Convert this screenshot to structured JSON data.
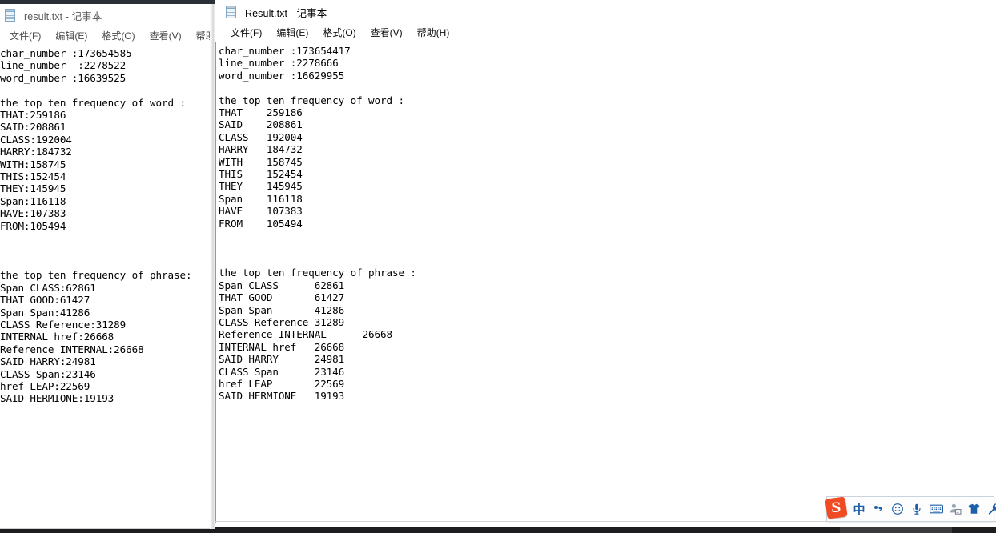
{
  "window_left": {
    "title": "result.txt - 记事本",
    "icon": "notepad-document-icon",
    "active": false,
    "menu": [
      {
        "label": "文件(F)",
        "name": "file"
      },
      {
        "label": "编辑(E)",
        "name": "edit"
      },
      {
        "label": "格式(O)",
        "name": "format"
      },
      {
        "label": "查看(V)",
        "name": "view"
      },
      {
        "label": "帮助(H)",
        "name": "help"
      }
    ],
    "content": "char_number :173654585\nline_number  :2278522\nword_number :16639525\n\nthe top ten frequency of word :\nTHAT:259186\nSAID:208861\nCLASS:192004\nHARRY:184732\nWITH:158745\nTHIS:152454\nTHEY:145945\nSpan:116118\nHAVE:107383\nFROM:105494\n\n\n\nthe top ten frequency of phrase:\nSpan CLASS:62861\nTHAT GOOD:61427\nSpan Span:41286\nCLASS Reference:31289\nINTERNAL href:26668\nReference INTERNAL:26668\nSAID HARRY:24981\nCLASS Span:23146\nhref LEAP:22569\nSAID HERMIONE:19193"
  },
  "window_right": {
    "title": "Result.txt - 记事本",
    "icon": "notepad-document-icon",
    "active": true,
    "menu": [
      {
        "label": "文件(F)",
        "name": "file"
      },
      {
        "label": "编辑(E)",
        "name": "edit"
      },
      {
        "label": "格式(O)",
        "name": "format"
      },
      {
        "label": "查看(V)",
        "name": "view"
      },
      {
        "label": "帮助(H)",
        "name": "help"
      }
    ],
    "content": "char_number :173654417\nline_number :2278666\nword_number :16629955\n\nthe top ten frequency of word :\nTHAT    259186\nSAID    208861\nCLASS   192004\nHARRY   184732\nWITH    158745\nTHIS    152454\nTHEY    145945\nSpan    116118\nHAVE    107383\nFROM    105494\n\n\n\nthe top ten frequency of phrase :\nSpan CLASS      62861\nTHAT GOOD       61427\nSpan Span       41286\nCLASS Reference 31289\nReference INTERNAL      26668\nINTERNAL href   26668\nSAID HARRY      24981\nCLASS Span      23146\nhref LEAP       22569\nSAID HERMIONE   19193"
  },
  "stats_right": {
    "char_number": "173654417",
    "line_number": "2278666",
    "word_number": "16629955"
  },
  "stats_left": {
    "char_number": "173654585",
    "line_number": "2278522",
    "word_number": "16639525"
  },
  "top_words": {
    "heading": "the top ten frequency of word :",
    "rows": [
      {
        "word": "THAT",
        "count": "259186"
      },
      {
        "word": "SAID",
        "count": "208861"
      },
      {
        "word": "CLASS",
        "count": "192004"
      },
      {
        "word": "HARRY",
        "count": "184732"
      },
      {
        "word": "WITH",
        "count": "158745"
      },
      {
        "word": "THIS",
        "count": "152454"
      },
      {
        "word": "THEY",
        "count": "145945"
      },
      {
        "word": "Span",
        "count": "116118"
      },
      {
        "word": "HAVE",
        "count": "107383"
      },
      {
        "word": "FROM",
        "count": "105494"
      }
    ]
  },
  "top_phrases": {
    "heading": "the top ten frequency of phrase :",
    "rows": [
      {
        "phrase": "Span CLASS",
        "count": "62861"
      },
      {
        "phrase": "THAT GOOD",
        "count": "61427"
      },
      {
        "phrase": "Span Span",
        "count": "41286"
      },
      {
        "phrase": "CLASS Reference",
        "count": "31289"
      },
      {
        "phrase": "Reference INTERNAL",
        "count": "26668"
      },
      {
        "phrase": "INTERNAL href",
        "count": "26668"
      },
      {
        "phrase": "SAID HARRY",
        "count": "24981"
      },
      {
        "phrase": "CLASS Span",
        "count": "23146"
      },
      {
        "phrase": "href LEAP",
        "count": "22569"
      },
      {
        "phrase": "SAID HERMIONE",
        "count": "19193"
      }
    ]
  },
  "ime_toolbar": {
    "name": "sogou-input-method-toolbar",
    "logo_letter": "S",
    "buttons": [
      {
        "name": "language-mode-chinese",
        "glyph": "中",
        "type": "text"
      },
      {
        "name": "punctuation-mode-icon",
        "glyph": "punct",
        "type": "icon"
      },
      {
        "name": "emoji-icon",
        "glyph": "emoji",
        "type": "icon"
      },
      {
        "name": "voice-input-icon",
        "glyph": "mic",
        "type": "icon"
      },
      {
        "name": "soft-keyboard-icon",
        "glyph": "keyboard",
        "type": "icon"
      },
      {
        "name": "user-account-icon",
        "glyph": "user",
        "type": "icon"
      },
      {
        "name": "skin-theme-icon",
        "glyph": "shirt",
        "type": "icon"
      },
      {
        "name": "toolbox-settings-icon",
        "glyph": "wrench",
        "type": "icon"
      }
    ]
  },
  "colors": {
    "accent_sogou": "#f04b23",
    "icon_blue": "#1d5fa8",
    "taskbar": "#1d1d1f",
    "window_bg": "#ffffff",
    "text": "#000000"
  }
}
